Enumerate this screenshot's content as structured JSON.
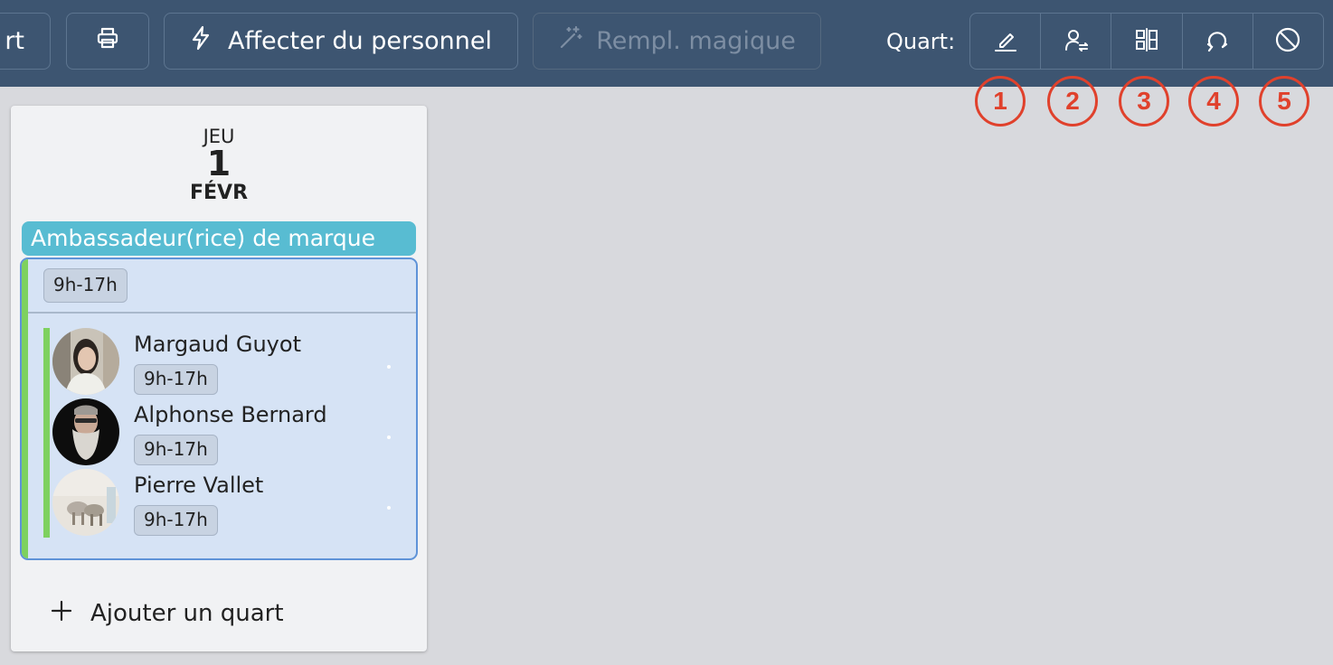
{
  "toolbar": {
    "cut_button_label": "rt",
    "print_icon": "printer-icon",
    "assign_label": "Affecter du personnel",
    "assign_icon": "lightning-icon",
    "magic_label": "Rempl. magique",
    "magic_icon": "magic-wand-icon",
    "shift_label": "Quart:",
    "shift_actions": [
      {
        "icon": "pencil-icon",
        "callout": "1"
      },
      {
        "icon": "user-swap-icon",
        "callout": "2"
      },
      {
        "icon": "split-icon",
        "callout": "3"
      },
      {
        "icon": "refresh-icon",
        "callout": "4"
      },
      {
        "icon": "cancel-icon",
        "callout": "5"
      }
    ]
  },
  "day": {
    "weekday": "JEU",
    "day_number": "1",
    "month": "FÉVR",
    "role": "Ambassadeur(rice) de marque",
    "shift": {
      "time": "9h-17h",
      "assignees": [
        {
          "name": "Margaud Guyot",
          "time": "9h-17h"
        },
        {
          "name": "Alphonse Bernard",
          "time": "9h-17h"
        },
        {
          "name": "Pierre Vallet",
          "time": "9h-17h"
        }
      ]
    },
    "add_shift_label": "Ajouter un quart"
  },
  "colors": {
    "toolbar_bg": "#3d5571",
    "role_bar": "#58bcd2",
    "shift_bg": "#d6e3f5",
    "shift_border": "#5f93d8",
    "status_green": "#7ed15f",
    "callout_red": "#e0412c"
  }
}
